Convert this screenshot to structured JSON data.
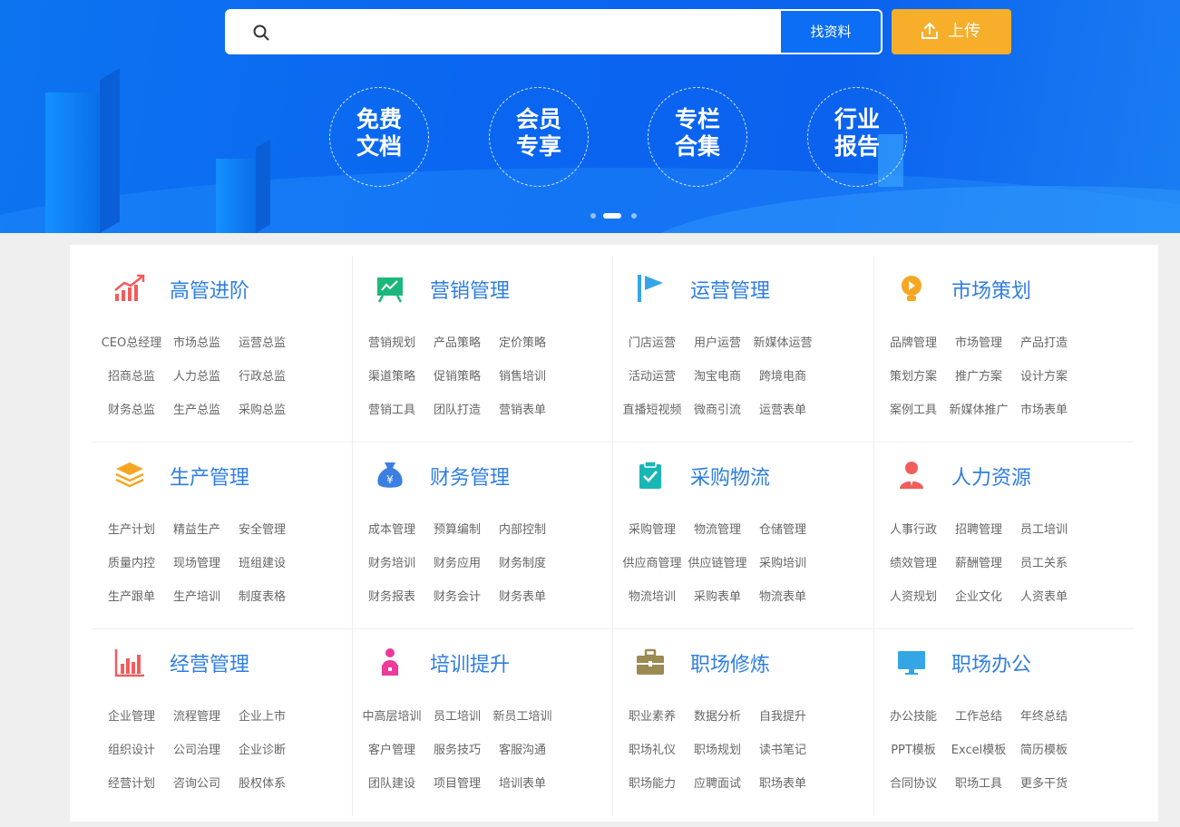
{
  "search": {
    "placeholder": "",
    "button_label": "找资料"
  },
  "upload": {
    "label": "上传"
  },
  "quick_links": [
    {
      "line1": "免费",
      "line2": "文档"
    },
    {
      "line1": "会员",
      "line2": "专享"
    },
    {
      "line1": "专栏",
      "line2": "合集"
    },
    {
      "line1": "行业",
      "line2": "报告"
    }
  ],
  "carousel": {
    "count": 3,
    "active": 2
  },
  "colors": {
    "banner": "#0b6ef5",
    "upload": "#f6ae2b",
    "category_title": "#2f7ee2"
  },
  "categories": [
    {
      "title": "高管进阶",
      "icon": "rising-chart-icon",
      "items": [
        "CEO总经理",
        "市场总监",
        "运营总监",
        "招商总监",
        "人力总监",
        "行政总监",
        "财务总监",
        "生产总监",
        "采购总监"
      ]
    },
    {
      "title": "营销管理",
      "icon": "presentation-board-icon",
      "items": [
        "营销规划",
        "产品策略",
        "定价策略",
        "渠道策略",
        "促销策略",
        "销售培训",
        "营销工具",
        "团队打造",
        "营销表单"
      ]
    },
    {
      "title": "运营管理",
      "icon": "flag-icon",
      "items": [
        "门店运营",
        "用户运营",
        "新媒体运营",
        "活动运营",
        "淘宝电商",
        "跨境电商",
        "直播短视频",
        "微商引流",
        "运营表单"
      ]
    },
    {
      "title": "市场策划",
      "icon": "lightbulb-icon",
      "items": [
        "品牌管理",
        "市场管理",
        "产品打造",
        "策划方案",
        "推广方案",
        "设计方案",
        "案例工具",
        "新媒体推广",
        "市场表单"
      ]
    },
    {
      "title": "生产管理",
      "icon": "layers-icon",
      "items": [
        "生产计划",
        "精益生产",
        "安全管理",
        "质量内控",
        "现场管理",
        "班组建设",
        "生产跟单",
        "生产培训",
        "制度表格"
      ]
    },
    {
      "title": "财务管理",
      "icon": "money-bag-icon",
      "items": [
        "成本管理",
        "预算编制",
        "内部控制",
        "财务培训",
        "财务应用",
        "财务制度",
        "财务报表",
        "财务会计",
        "财务表单"
      ]
    },
    {
      "title": "采购物流",
      "icon": "clipboard-check-icon",
      "items": [
        "采购管理",
        "物流管理",
        "仓储管理",
        "供应商管理",
        "供应链管理",
        "采购培训",
        "物流培训",
        "采购表单",
        "物流表单"
      ]
    },
    {
      "title": "人力资源",
      "icon": "person-icon",
      "items": [
        "人事行政",
        "招聘管理",
        "员工培训",
        "绩效管理",
        "薪酬管理",
        "员工关系",
        "人资规划",
        "企业文化",
        "人资表单"
      ]
    },
    {
      "title": "经营管理",
      "icon": "bar-chart-icon",
      "items": [
        "企业管理",
        "流程管理",
        "企业上市",
        "组织设计",
        "公司治理",
        "企业诊断",
        "经营计划",
        "咨询公司",
        "股权体系"
      ]
    },
    {
      "title": "培训提升",
      "icon": "lecturer-icon",
      "items": [
        "中高层培训",
        "员工培训",
        "新员工培训",
        "客户管理",
        "服务技巧",
        "客服沟通",
        "团队建设",
        "项目管理",
        "培训表单"
      ]
    },
    {
      "title": "职场修炼",
      "icon": "briefcase-icon",
      "items": [
        "职业素养",
        "数据分析",
        "自我提升",
        "职场礼仪",
        "职场规划",
        "读书笔记",
        "职场能力",
        "应聘面试",
        "职场表单"
      ]
    },
    {
      "title": "职场办公",
      "icon": "monitor-icon",
      "items": [
        "办公技能",
        "工作总结",
        "年终总结",
        "PPT模板",
        "Excel模板",
        "简历模板",
        "合同协议",
        "职场工具",
        "更多干货"
      ]
    }
  ]
}
